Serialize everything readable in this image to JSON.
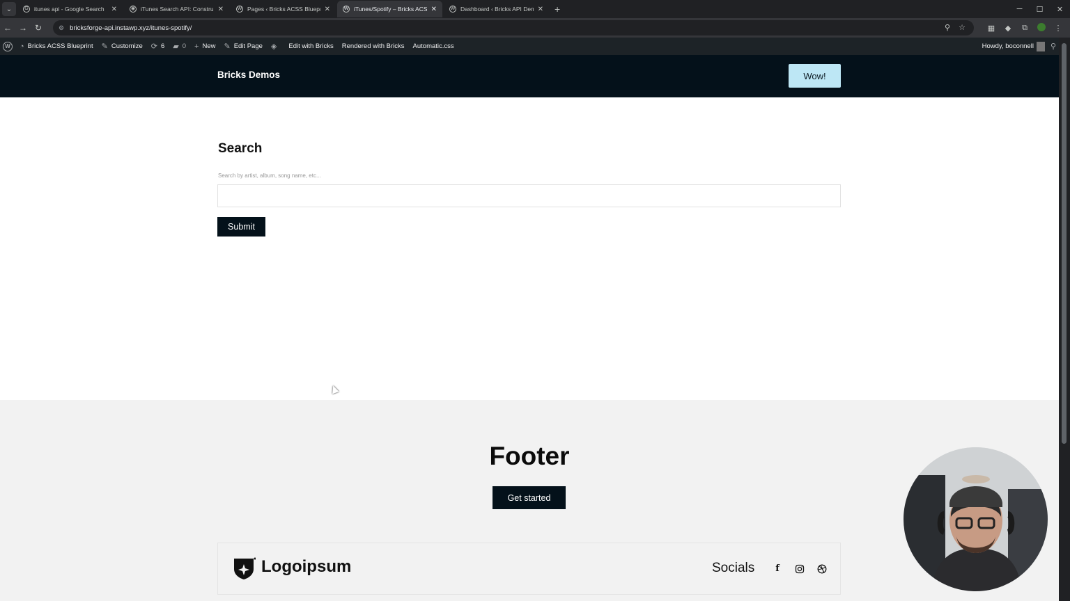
{
  "browser": {
    "tabs": [
      {
        "title": "itunes api - Google Search",
        "active": false
      },
      {
        "title": "iTunes Search API: Constructing",
        "active": false
      },
      {
        "title": "Pages ‹ Bricks ACSS Blueprint –",
        "active": false
      },
      {
        "title": "iTunes/Spotify – Bricks ACSS Bl",
        "active": true
      },
      {
        "title": "Dashboard ‹ Bricks API Demo –",
        "active": false
      }
    ],
    "url": "bricksforge-api.instawp.xyz/itunes-spotify/"
  },
  "adminbar": {
    "site_name": "Bricks ACSS Blueprint",
    "customize": "Customize",
    "updates_count": "6",
    "comments_count": "0",
    "new_label": "New",
    "edit_page": "Edit Page",
    "edit_with_bricks": "Edit with Bricks",
    "rendered_with": "Rendered with Bricks",
    "automatic_css": "Automatic.css",
    "howdy": "Howdy, boconnell"
  },
  "header": {
    "brand": "Bricks Demos",
    "cta": "Wow!"
  },
  "search": {
    "title": "Search",
    "label": "Search by artist, album, song name, etc...",
    "value": "",
    "submit": "Submit"
  },
  "footer": {
    "title": "Footer",
    "cta": "Get started",
    "logo_text": "Logoipsum",
    "socials_label": "Socials",
    "social_icons": [
      "facebook-icon",
      "instagram-icon",
      "dribbble-icon"
    ]
  },
  "colors": {
    "header_bg": "#04111a",
    "wow_button": "#bde7f5",
    "footer_bg": "#f2f2f2",
    "adminbar_bg": "#1d2327"
  }
}
